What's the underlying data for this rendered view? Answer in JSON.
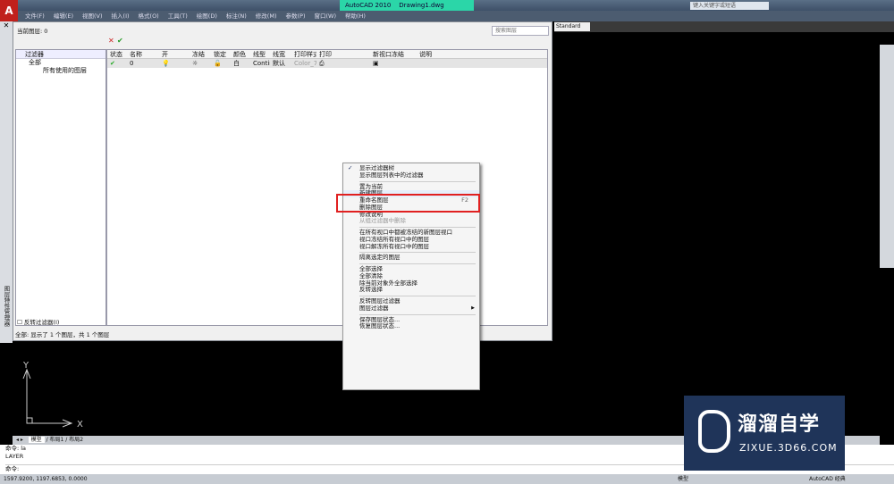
{
  "app": {
    "title": "AutoCAD 2010",
    "document": "Drawing1.dwg",
    "search_placeholder": "键入关键字或短语",
    "style": "Standard"
  },
  "menu": [
    "文件(F)",
    "编辑(E)",
    "视图(V)",
    "插入(I)",
    "格式(O)",
    "工具(T)",
    "绘图(D)",
    "标注(N)",
    "修改(M)",
    "参数(P)",
    "窗口(W)",
    "帮助(H)"
  ],
  "dialog": {
    "current_layer": "当前图层: 0",
    "search_placeholder": "搜索图层",
    "tree_header": "过滤器",
    "tree_items": [
      "全部",
      "所有使用的图层"
    ],
    "columns": [
      "状态",
      "名称",
      "开",
      "冻结",
      "锁定",
      "颜色",
      "线型",
      "线宽",
      "打印样式",
      "打印",
      "新视口冻结",
      "说明"
    ],
    "rows": [
      {
        "name": "0",
        "color": "白",
        "linetype": "Continu...",
        "lineweight": "默认",
        "plotstyle": "Color_7"
      }
    ],
    "invert_filter": "反转过滤器(I)",
    "status": "全部: 显示了 1 个图层，共 1 个图层",
    "side_label": "图层特性管理器"
  },
  "context_menu": [
    {
      "label": "显示过滤器树",
      "checked": true
    },
    {
      "label": "显示图层列表中的过滤器"
    },
    {
      "sep": true
    },
    {
      "label": "置为当前"
    },
    {
      "label": "新建图层",
      "highlighted": true
    },
    {
      "label": "重命名图层",
      "shortcut": "F2"
    },
    {
      "label": "删除图层"
    },
    {
      "label": "修改说明"
    },
    {
      "label": "从组过滤器中删除",
      "disabled": true
    },
    {
      "sep": true
    },
    {
      "label": "在所有视口中都被冻结的新图层视口"
    },
    {
      "label": "视口冻结所有视口中的图层"
    },
    {
      "label": "视口解冻所有视口中的图层"
    },
    {
      "sep": true
    },
    {
      "label": "隔离选定的图层"
    },
    {
      "sep": true
    },
    {
      "label": "全部选择"
    },
    {
      "label": "全部清除"
    },
    {
      "label": "除当前对象外全部选择"
    },
    {
      "label": "反转选择"
    },
    {
      "sep": true
    },
    {
      "label": "反转图层过滤器"
    },
    {
      "label": "图层过滤器",
      "submenu": true
    },
    {
      "sep": true
    },
    {
      "label": "保存图层状态..."
    },
    {
      "label": "恢复图层状态..."
    }
  ],
  "ucs": {
    "x": "X",
    "y": "Y"
  },
  "tabs": [
    "模型",
    "布局1",
    "布局2"
  ],
  "command": {
    "lines": [
      "命令: la",
      "LAYER"
    ],
    "prompt": "命令:"
  },
  "statusbar": {
    "coords": "1597.9200, 1197.6853, 0.0000",
    "model": "模型",
    "workspace": "AutoCAD 经典"
  },
  "watermark": {
    "name": "溜溜自学",
    "url": "ZIXUE.3D66.COM"
  }
}
